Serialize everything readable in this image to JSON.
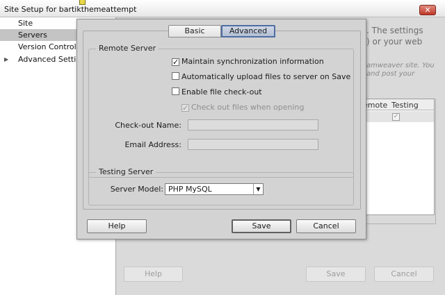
{
  "window": {
    "title": "Site Setup for bartikthemeattempt",
    "close_glyph": "✕"
  },
  "sidebar": {
    "items": [
      {
        "label": "Site"
      },
      {
        "label": "Servers"
      },
      {
        "label": "Version Control"
      },
      {
        "label": "Advanced Settings",
        "expand_glyph": "▶"
      }
    ]
  },
  "background": {
    "text_line1": ". The settings",
    "text_line2": ") or your web",
    "hint_line1": "amweaver site. You",
    "hint_line2": "and post your",
    "table": {
      "col_remote": "emote",
      "col_testing": "Testing",
      "testing_check": "✓"
    },
    "help_label": "Help",
    "save_label": "Save",
    "cancel_label": "Cancel"
  },
  "dialog": {
    "tabs": [
      {
        "label": "Basic"
      },
      {
        "label": "Advanced"
      }
    ],
    "remote_server": {
      "legend": "Remote Server",
      "maintain_sync": {
        "label": "Maintain synchronization information",
        "checked": true,
        "glyph": "✓"
      },
      "auto_upload": {
        "label": "Automatically upload files to server on Save",
        "checked": false
      },
      "enable_checkout": {
        "label": "Enable file check-out",
        "checked": false
      },
      "checkout_on_open": {
        "label": "Check out files when opening",
        "checked": true,
        "disabled": true,
        "glyph": "✓"
      },
      "checkout_name_label": "Check-out Name:",
      "checkout_name_value": "",
      "email_label": "Email Address:",
      "email_value": ""
    },
    "testing_server": {
      "legend": "Testing Server",
      "server_model_label": "Server Model:",
      "server_model_value": "PHP MySQL",
      "dropdown_glyph": "▼"
    },
    "buttons": {
      "help": "Help",
      "save": "Save",
      "cancel": "Cancel"
    }
  }
}
